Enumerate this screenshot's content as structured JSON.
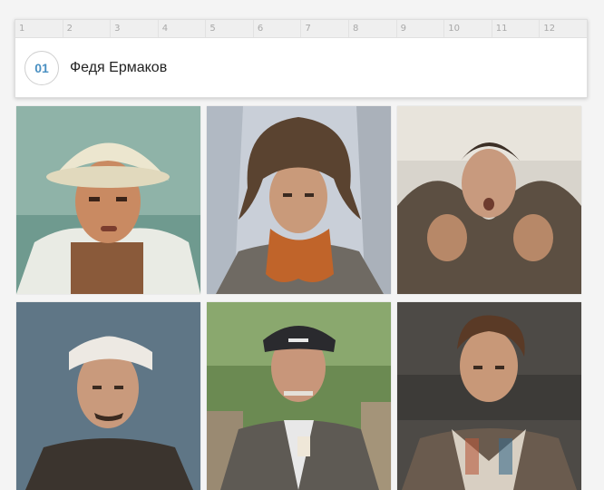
{
  "ruler": {
    "columns": [
      "1",
      "2",
      "3",
      "4",
      "5",
      "6",
      "7",
      "8",
      "9",
      "10",
      "11",
      "12"
    ]
  },
  "item": {
    "number": "01",
    "name": "Федя Ермаков"
  },
  "photos": [
    {
      "icon": "portrait-pith-helmet"
    },
    {
      "icon": "portrait-fur-hat"
    },
    {
      "icon": "portrait-fur-collar"
    },
    {
      "icon": "portrait-bandaged-head"
    },
    {
      "icon": "portrait-captain-cap"
    },
    {
      "icon": "portrait-plaid-shirt"
    }
  ]
}
